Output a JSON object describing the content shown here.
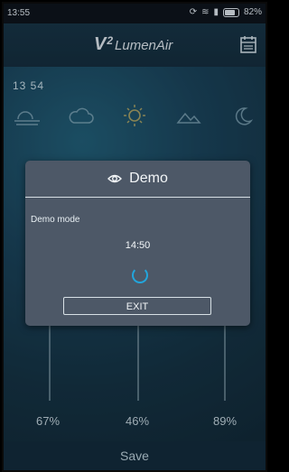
{
  "status_bar": {
    "time": "13:55",
    "battery": "82%"
  },
  "header": {
    "logo_main": "V",
    "logo_sup": "2",
    "logo_text": "LumenAir"
  },
  "background": {
    "clock": "13 54",
    "percentages": [
      "67%",
      "46%",
      "89%"
    ],
    "save_label": "Save"
  },
  "dialog": {
    "title": "Demo",
    "mode_label": "Demo mode",
    "time": "14:50",
    "exit_label": "EXIT"
  },
  "colors": {
    "dialog_bg": "#4d5867",
    "accent": "#22a6dd",
    "header_bg": "#0f2c3c"
  }
}
